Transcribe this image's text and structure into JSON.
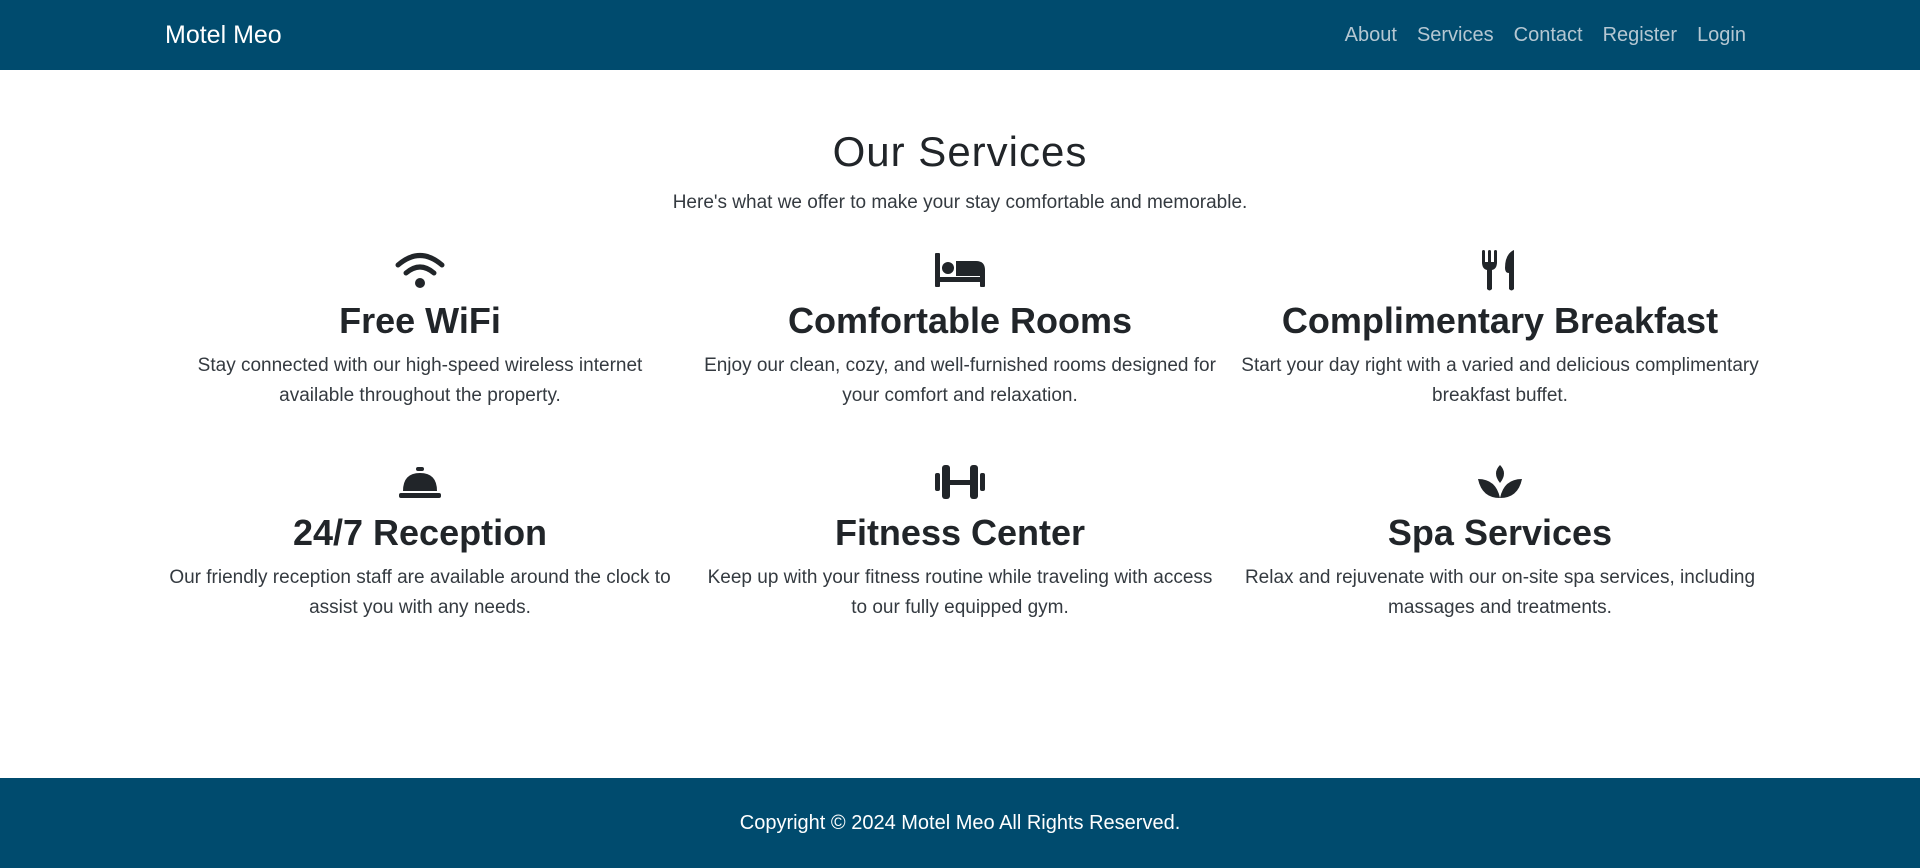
{
  "navbar": {
    "brand": "Motel Meo",
    "links": [
      "About",
      "Services",
      "Contact",
      "Register",
      "Login"
    ]
  },
  "main": {
    "title": "Our Services",
    "subtitle": "Here's what we offer to make your stay comfortable and memorable.",
    "services": [
      {
        "icon": "wifi-icon",
        "title": "Free WiFi",
        "text": "Stay connected with our high-speed wireless internet available throughout the property."
      },
      {
        "icon": "bed-icon",
        "title": "Comfortable Rooms",
        "text": "Enjoy our clean, cozy, and well-furnished rooms designed for your comfort and relaxation."
      },
      {
        "icon": "utensils-icon",
        "title": "Complimentary Breakfast",
        "text": "Start your day right with a varied and delicious complimentary breakfast buffet."
      },
      {
        "icon": "concierge-bell-icon",
        "title": "24/7 Reception",
        "text": "Our friendly reception staff are available around the clock to assist you with any needs."
      },
      {
        "icon": "dumbbell-icon",
        "title": "Fitness Center",
        "text": "Keep up with your fitness routine while traveling with access to our fully equipped gym."
      },
      {
        "icon": "spa-icon",
        "title": "Spa Services",
        "text": "Relax and rejuvenate with our on-site spa services, including massages and treatments."
      }
    ]
  },
  "footer": {
    "text": "Copyright © 2024 Motel Meo All Rights Reserved."
  },
  "colors": {
    "navbar_bg": "#004b6e",
    "nav_link": "#b5c7d2",
    "text": "#212529"
  }
}
